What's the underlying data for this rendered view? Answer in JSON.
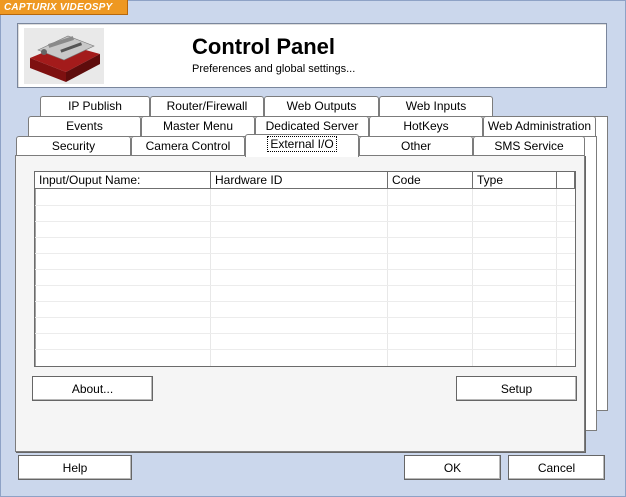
{
  "app": {
    "brand": "CAPTURIX VIDEOSPY"
  },
  "header": {
    "title": "Control Panel",
    "subtitle": "Preferences and global settings..."
  },
  "tabs": {
    "row1": [
      "IP Publish",
      "Router/Firewall",
      "Web Outputs",
      "Web Inputs"
    ],
    "row2": [
      "Events",
      "Master Menu",
      "Dedicated Server",
      "HotKeys",
      "Web Administration"
    ],
    "row3": [
      "Security",
      "Camera Control",
      "External I/O",
      "Other",
      "SMS Service"
    ],
    "active": "External I/O"
  },
  "grid": {
    "columns": [
      "Input/Ouput Name:",
      "Hardware ID",
      "Code",
      "Type"
    ],
    "rows": []
  },
  "panel_buttons": {
    "about": "About...",
    "setup": "Setup"
  },
  "footer": {
    "help": "Help",
    "ok": "OK",
    "cancel": "Cancel"
  },
  "colors": {
    "background": "#cbd7ec",
    "brand_tag": "#ee9822"
  }
}
